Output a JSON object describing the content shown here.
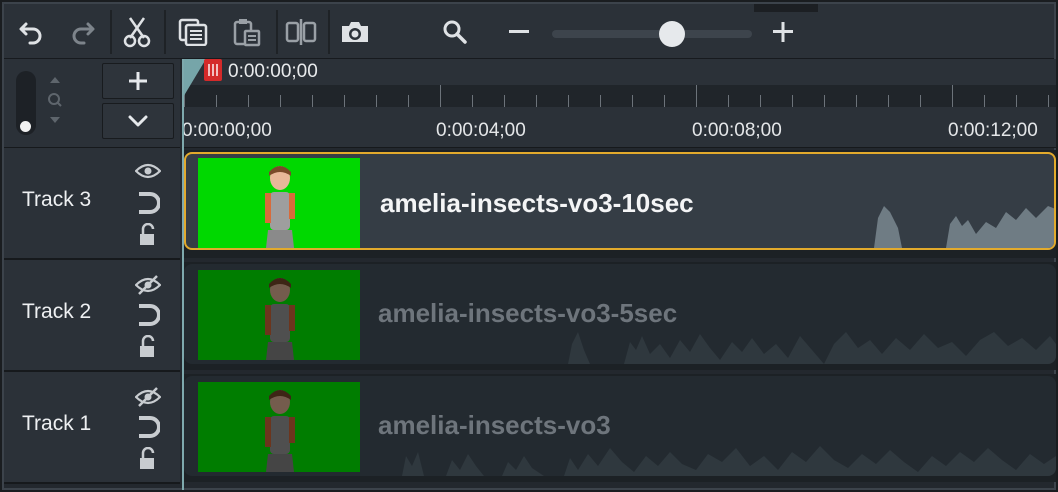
{
  "ruler": {
    "playhead_time": "0:00:00;00",
    "labels": [
      "0:00:00;00",
      "0:00:04;00",
      "0:00:08;00",
      "0:00:12;00"
    ]
  },
  "toolbar": {
    "icons": [
      "undo-icon",
      "redo-icon",
      "cut-icon",
      "copy-icon",
      "paste-icon",
      "split-icon",
      "snapshot-icon",
      "zoom-search-icon",
      "zoom-out-icon",
      "zoom-in-icon"
    ],
    "zoom_level": 0.54
  },
  "tracks": [
    {
      "name": "Track 3",
      "clip": "amelia-insects-vo3-10sec",
      "visible": true,
      "selected": true
    },
    {
      "name": "Track 2",
      "clip": "amelia-insects-vo3-5sec",
      "visible": false,
      "selected": false
    },
    {
      "name": "Track 1",
      "clip": "amelia-insects-vo3",
      "visible": false,
      "selected": false
    }
  ],
  "colors": {
    "accent_selected": "#e2aa2c",
    "green_active": "#00d800",
    "green_dim": "#007d00",
    "playhead": "#d42a2a"
  }
}
